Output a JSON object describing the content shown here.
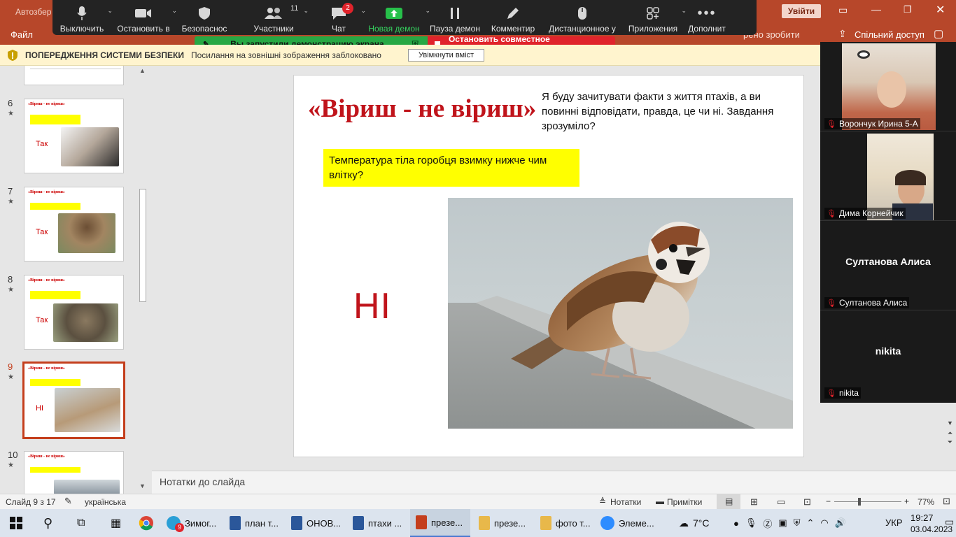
{
  "window": {
    "title_left": "Автозбер",
    "signin": "Увійти"
  },
  "ribbon": {
    "file": "Файл",
    "tell_me": "рено зробити",
    "share": "Спільний доступ"
  },
  "zoom": {
    "buttons": [
      {
        "label": "Выключить",
        "icon": "microphone-icon"
      },
      {
        "label": "Остановить в",
        "icon": "video-camera-icon"
      },
      {
        "label": "Безопаснос",
        "icon": "shield-icon"
      },
      {
        "label": "Участники",
        "icon": "people-icon",
        "count": "11"
      },
      {
        "label": "Чат",
        "icon": "chat-icon",
        "badge": "2"
      },
      {
        "label": "Новая демон",
        "icon": "share-screen-icon"
      },
      {
        "label": "Пауза демон",
        "icon": "pause-icon"
      },
      {
        "label": "Комментир",
        "icon": "pencil-icon"
      },
      {
        "label": "Дистанционное у",
        "icon": "mouse-icon"
      },
      {
        "label": "Приложения",
        "icon": "apps-icon"
      },
      {
        "label": "Дополнит",
        "icon": "more-icon"
      }
    ],
    "sharing_msg": "Вы запустили демонстрацию экрана",
    "stop_msg": "Остановить совместное использование"
  },
  "warning": {
    "title": "ПОПЕРЕДЖЕННЯ СИСТЕМИ БЕЗПЕКИ",
    "message": "Посилання на зовнішні зображення заблоковано",
    "button": "Увімкнути вміст"
  },
  "thumbnails": [
    {
      "num": "6",
      "answer": "Так"
    },
    {
      "num": "7",
      "answer": "Так"
    },
    {
      "num": "8",
      "answer": "Так"
    },
    {
      "num": "9",
      "answer": "НІ"
    },
    {
      "num": "10",
      "answer": ""
    }
  ],
  "thumb_common": {
    "title": "«Віриш - не віриш»",
    "star": "★"
  },
  "slide": {
    "title": "«Віриш - не віриш»",
    "intro": "Я буду зачитувати факти з життя птахів, а ви повинні відповідати, правда, це чи ні. Завдання зрозуміло?",
    "question": "Температура тіла горобця  взимку нижче чим влітку?",
    "answer": "НІ"
  },
  "notes_placeholder": "Нотатки до слайда",
  "participants": [
    {
      "name": "Ворончук Ирина 5-А",
      "video": true
    },
    {
      "name": "Дима Корнейчик",
      "video": true
    },
    {
      "name": "Султанова Алиса",
      "video": false,
      "big": "Султанова Алиса"
    },
    {
      "name": "nikita",
      "video": false,
      "big": "nikita"
    }
  ],
  "status": {
    "slide_info": "Слайд 9 з 17",
    "language": "українська",
    "notes": "Нотатки",
    "comments": "Примітки",
    "zoom": "77%"
  },
  "taskbar": {
    "items": [
      {
        "label": "Зимог...",
        "color": "#2a9fd6",
        "badge": "9"
      },
      {
        "label": "план т...",
        "color": "#2b579a"
      },
      {
        "label": "ОНОВ...",
        "color": "#2b579a"
      },
      {
        "label": "птахи ...",
        "color": "#2b579a"
      },
      {
        "label": "презе...",
        "color": "#c43e1c",
        "active": true
      },
      {
        "label": "презе...",
        "color": "#e8b84a"
      },
      {
        "label": "фото т...",
        "color": "#e8b84a"
      },
      {
        "label": "Элеме...",
        "color": "#2d8cff"
      }
    ],
    "weather": "7°C",
    "lang": "УКР",
    "time": "19:27",
    "date": "03.04.2023"
  },
  "colors": {
    "brand": "#b7472a",
    "zoom_green": "#27a844",
    "zoom_red": "#e0232b",
    "title_red": "#c0141b",
    "highlight": "#ffff00"
  }
}
